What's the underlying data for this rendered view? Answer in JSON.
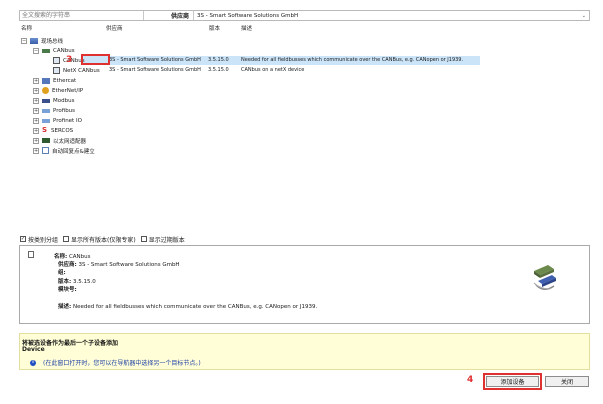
{
  "search": {
    "placeholder": "全文搜索的字符串"
  },
  "vendor": {
    "label": "供应商",
    "value": "3S - Smart Software Solutions GmbH"
  },
  "columns": {
    "name": "名称",
    "vendor": "供应商",
    "version": "版本",
    "description": "描述"
  },
  "tree": {
    "root": "现场总线",
    "canbus_group": "CANbus",
    "rows": [
      {
        "name": "CANbus",
        "vendor": "3S - Smart Software Solutions GmbH",
        "version": "3.5.15.0",
        "description": "Needed for all fieldbusses which communicate over the CANBus, e.g. CANopen or J1939."
      },
      {
        "name": "NetX CANbus",
        "vendor": "3S - Smart Software Solutions GmbH",
        "version": "3.5.15.0",
        "description": "CANbus on a netX device"
      }
    ],
    "others": [
      "Ethercat",
      "EtherNet/IP",
      "Modbus",
      "Profibus",
      "Profinet IO",
      "SERCOS",
      "以太网适配器",
      "自动回复点&建立"
    ]
  },
  "annotations": {
    "step3": "3",
    "step4": "4"
  },
  "options": {
    "group_by_category": "按类别分组",
    "show_all_versions": "显示所有版本(仅限专家)",
    "show_outdated": "显示过期版本"
  },
  "info": {
    "name_label": "名称:",
    "name": "CANbus",
    "vendor_label": "供应商:",
    "vendor": "3S - Smart Software Solutions GmbH",
    "group_label": "组:",
    "group": "",
    "version_label": "版本:",
    "version": "3.5.15.0",
    "model_label": "模块号:",
    "model": "",
    "desc_label": "描述:",
    "desc": "Needed for all fieldbusses which communicate over the CANBus, e.g. CANopen or J1939."
  },
  "hint": {
    "title": "将被选设备作为最后一个子设备添加",
    "device": "Device",
    "info": "(在此窗口打开时，您可以在导航器中选择另一个目标节点。)"
  },
  "buttons": {
    "add": "添加设备",
    "close": "关闭"
  },
  "colors": {
    "selected_row": "#cbe4f8",
    "annotation": "#e03131",
    "hint_bg": "#fffed6"
  }
}
